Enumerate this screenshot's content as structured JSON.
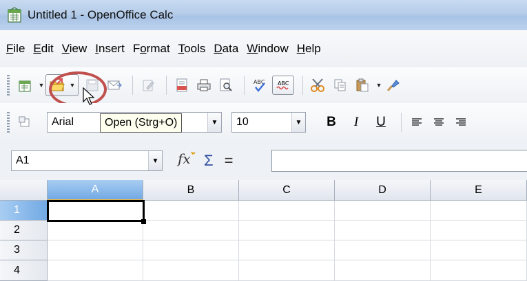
{
  "window": {
    "title": "Untitled 1 - OpenOffice Calc"
  },
  "menu": [
    "File",
    "Edit",
    "View",
    "Insert",
    "Format",
    "Tools",
    "Data",
    "Window",
    "Help"
  ],
  "menu_mnemonics": [
    "F",
    "E",
    "V",
    "I",
    "o",
    "T",
    "D",
    "W",
    "H"
  ],
  "toolbar": {
    "tooltip": "Open (Strg+O)",
    "font_name": "Arial",
    "font_size": "10",
    "bold": "B",
    "italic": "I",
    "underline": "U",
    "spell_label": "ABC"
  },
  "formula_bar": {
    "name_box": "A1",
    "sum_symbol": "Σ",
    "equals": "="
  },
  "grid": {
    "columns": [
      "A",
      "B",
      "C",
      "D",
      "E"
    ],
    "rows": [
      "1",
      "2",
      "3",
      "4"
    ],
    "active_cell": "A1"
  },
  "colors": {
    "highlight_ring": "#c0504d",
    "active_header": "#72a9e4",
    "title_bar": "#b6cde9"
  }
}
